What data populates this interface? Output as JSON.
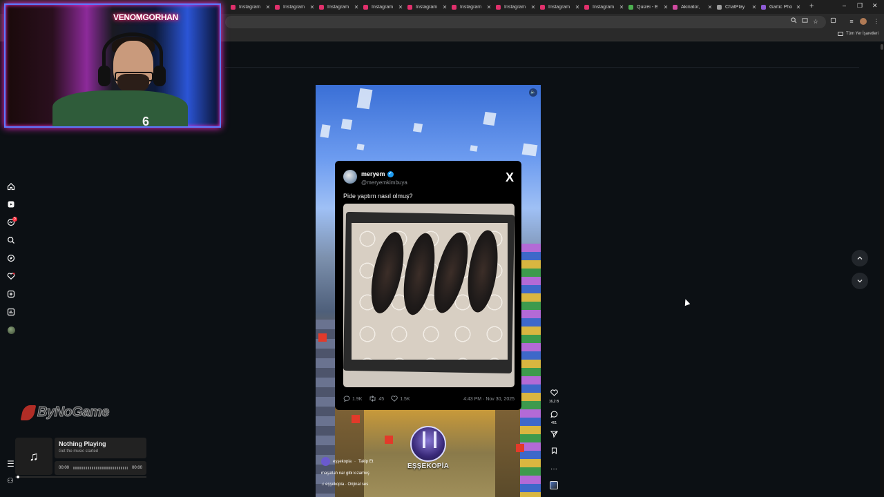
{
  "browser": {
    "tabs": [
      {
        "title": "Instagram",
        "color": "#e1306c"
      },
      {
        "title": "Instagram",
        "color": "#e1306c"
      },
      {
        "title": "Instagram",
        "color": "#e1306c"
      },
      {
        "title": "Instagram",
        "color": "#e1306c"
      },
      {
        "title": "Instagram",
        "color": "#e1306c"
      },
      {
        "title": "Instagram",
        "color": "#e1306c"
      },
      {
        "title": "Instagram",
        "color": "#e1306c"
      },
      {
        "title": "Instagram",
        "color": "#e1306c"
      },
      {
        "title": "Instagram",
        "color": "#e1306c"
      },
      {
        "title": "Quizei - E",
        "color": "#4caf50"
      },
      {
        "title": "Akinator,",
        "color": "#d04aa0"
      },
      {
        "title": "ChatPlay",
        "color": "#9e9e9e"
      },
      {
        "title": "Gartic Pho",
        "color": "#8e5bd6"
      }
    ],
    "tab_close": "✕",
    "new_tab": "+",
    "window_minimize": "–",
    "window_maximize": "❐",
    "window_close": "✕",
    "bookmarks_all_label": "Tüm Yer İşaretleri"
  },
  "webcam": {
    "neon_sign": "VENOMGORHAN",
    "shirt_number": "6"
  },
  "sidebar": {
    "items": [
      {
        "icon": "home-icon"
      },
      {
        "icon": "reels-icon"
      },
      {
        "icon": "messages-icon",
        "badge": "5"
      },
      {
        "icon": "search-icon"
      },
      {
        "icon": "explore-icon"
      },
      {
        "icon": "notifications-icon"
      },
      {
        "icon": "create-icon"
      },
      {
        "icon": "dashboard-icon"
      },
      {
        "icon": "profile-avatar"
      }
    ],
    "menu_icon": "☰",
    "more_icon": "⚇"
  },
  "watermark": {
    "text": "ByNoGame"
  },
  "music": {
    "icon": "♫",
    "title": "Nothing Playing",
    "subtitle": "Get the music started",
    "time_start": "00:00",
    "time_end": "00:00"
  },
  "tweet": {
    "name": "meryem",
    "verified": "✓",
    "handle": "@meryemkimbuya",
    "x_logo": "X",
    "text": "Pide yaptım nasıl olmuş?",
    "replies": "1.9K",
    "retweets": "45",
    "likes": "1.5K",
    "timestamp": "4:43 PM · Nov 30, 2025"
  },
  "reel": {
    "mute_icon": "🔈",
    "channel_name": "EŞŞEKOPİA",
    "author": "eşşekopia",
    "follow_label": "Takip Et",
    "caption": "maşallah nar gibi kızarmış",
    "audio": "♫ eşşekopia · Orijinal ses",
    "likes": "16,2 B",
    "comments": "461"
  }
}
